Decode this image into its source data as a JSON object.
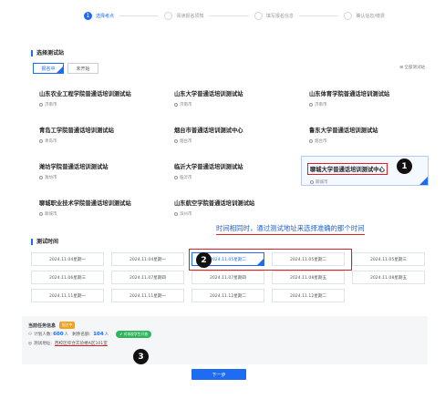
{
  "steps": [
    {
      "index": "1",
      "label": "选择考点"
    },
    {
      "index": "",
      "label": "阅读报名须知"
    },
    {
      "index": "",
      "label": "填写报名信息"
    },
    {
      "index": "",
      "label": "确认信息/缴费"
    }
  ],
  "station_section": {
    "title": "选择测试站",
    "tabs": [
      "报名中",
      "未开始"
    ],
    "all_link": "全部测试站"
  },
  "stations": [
    {
      "name": "山东农业工程学院普通话培训测试站",
      "city": "济南市"
    },
    {
      "name": "山东大学普通话培训测试站",
      "city": "济南市"
    },
    {
      "name": "山东体育学院普通话培训测试站",
      "city": "济南市"
    },
    {
      "name": "青岛工学院普通话培训测试站",
      "city": "青岛市"
    },
    {
      "name": "烟台市普通话培训测试中心",
      "city": "烟台市"
    },
    {
      "name": "鲁东大学普通话培训测试站",
      "city": "烟台市"
    },
    {
      "name": "潍坊学院普通话培训测试站",
      "city": "潍坊市"
    },
    {
      "name": "临沂大学普通话培训测试站",
      "city": "临沂市"
    },
    {
      "name": "聊城大学普通话培训测试中心",
      "city": "聊城市"
    },
    {
      "name": "聊城职业技术学院普通话培训测试站",
      "city": "聊城市"
    },
    {
      "name": "山东航空学院普通话培训测试站",
      "city": "滨州市"
    }
  ],
  "annotation_text": "时间相同时，通过测试地址来选择准确的那个时间",
  "badges": {
    "one": "1",
    "two": "2",
    "three": "3"
  },
  "time_section": {
    "title": "测试时间"
  },
  "times": [
    "2024.11.04星期一",
    "2024.11.04星期一",
    "2024.11.05星期二",
    "2024.11.05星期二",
    "2024.11.05星期三",
    "2024.11.06星期三",
    "2024.11.07星期四",
    "2024.11.07星期四",
    "2024.11.08星期五",
    "2024.11.08星期五",
    "2024.11.11星期一",
    "2024.11.11星期一",
    "2024.11.12星期二",
    "2024.11.12星期二"
  ],
  "info": {
    "title": "当前任务信息",
    "status_tag": "报名中",
    "plan_label": "计划人数:",
    "plan_value": "600",
    "person_unit": "人",
    "remaining_label": "剩余名额:",
    "remaining_value": "104",
    "green_tag": "对本校学生开放",
    "address_label": "测试地址:",
    "address_value": "西校区综合实验楼A区101室"
  },
  "next_button": "下一步",
  "colors": {
    "accent": "#1d6cf2",
    "highlight": "#e02020",
    "tag_orange": "#f7a11a",
    "tag_green": "#2fb55b"
  }
}
